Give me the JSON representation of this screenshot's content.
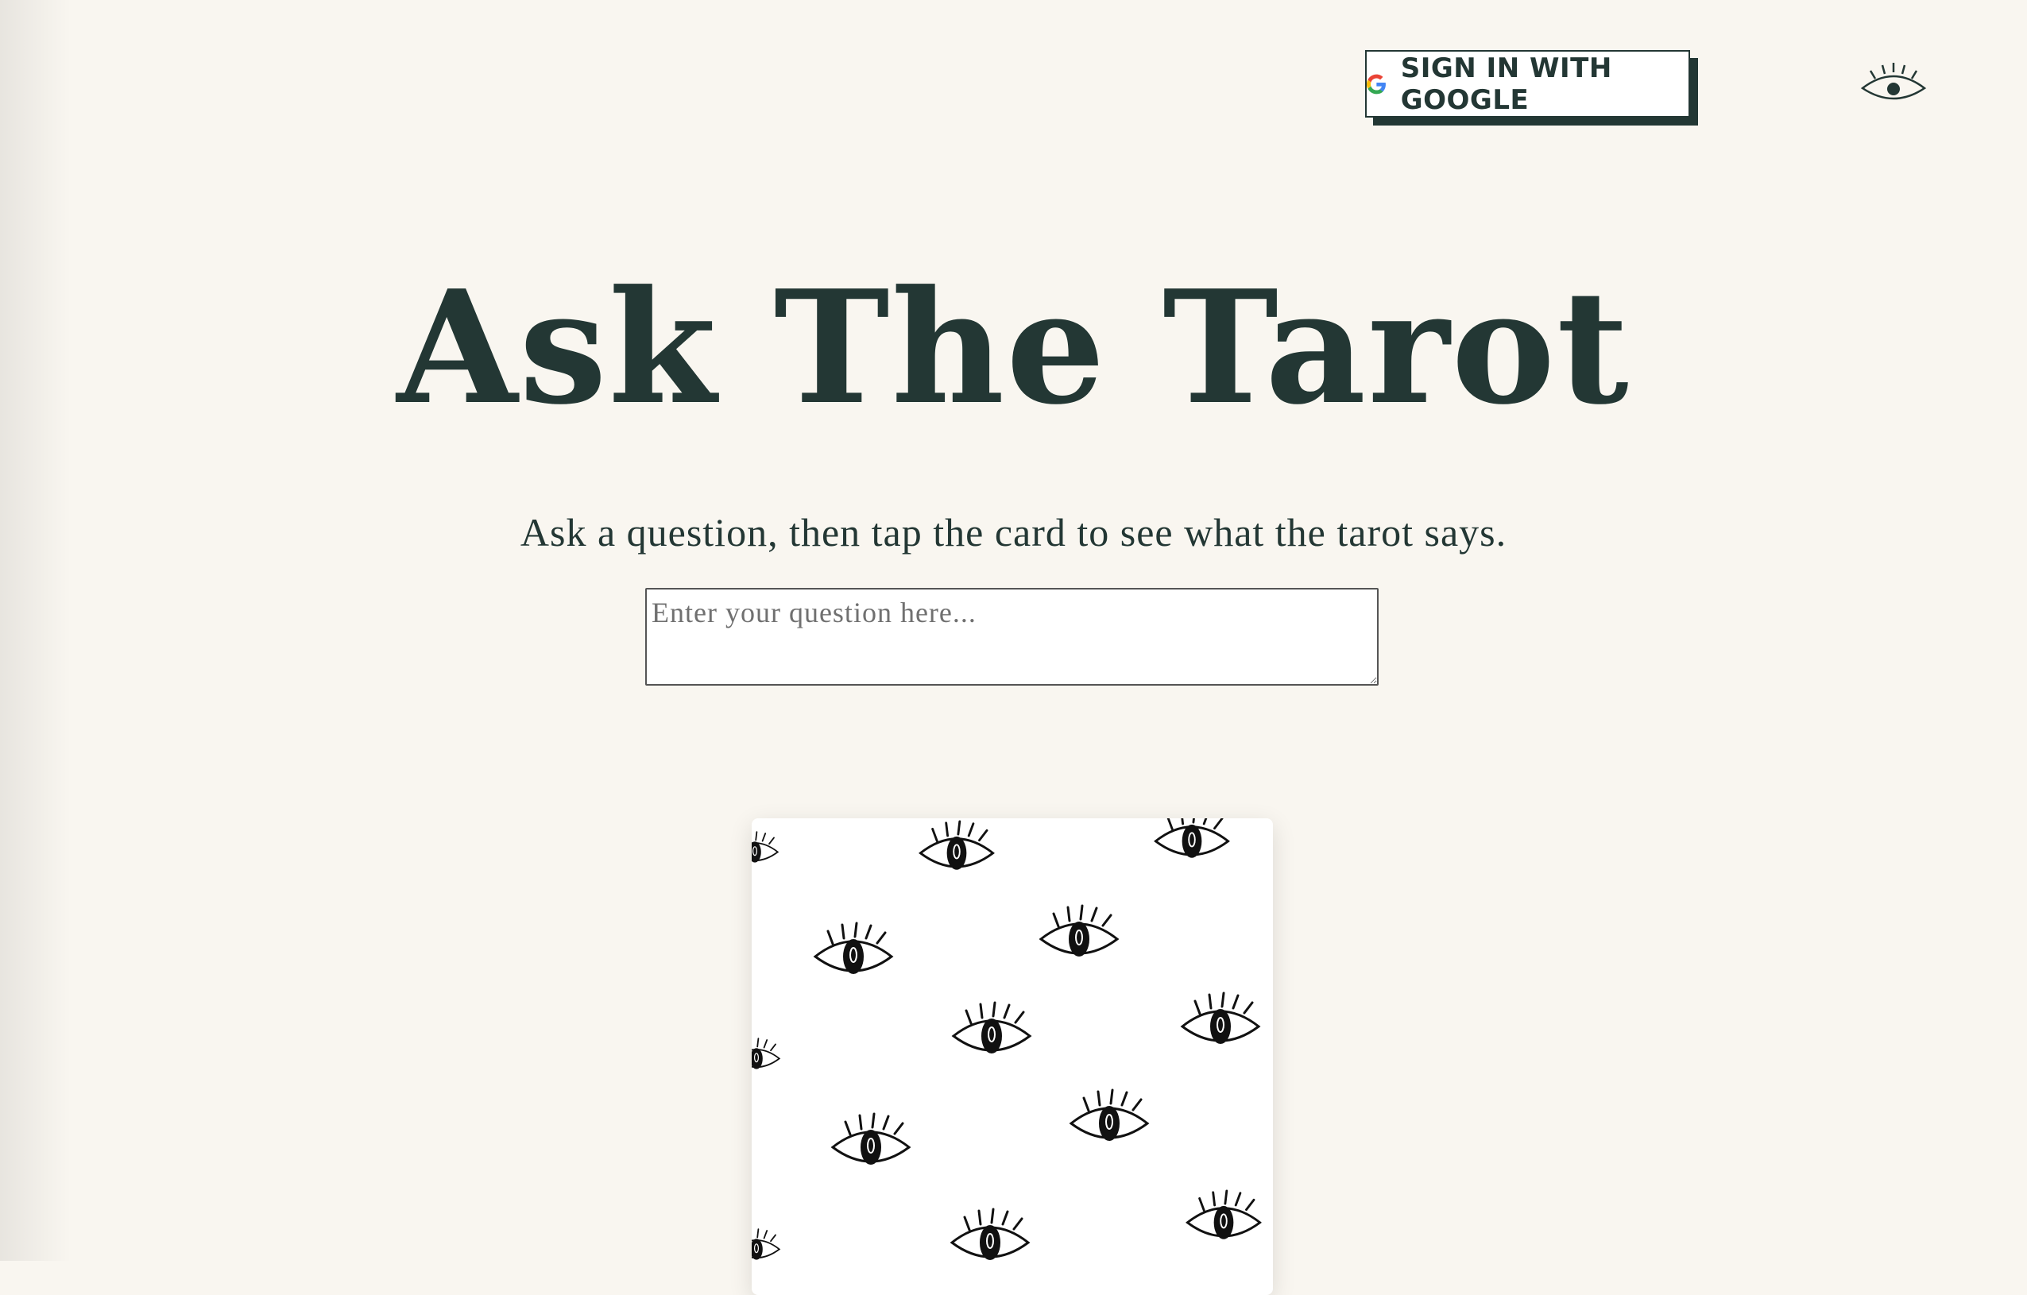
{
  "header": {
    "signin_label": "SIGN IN WITH GOOGLE",
    "google_colors": [
      "#4285F4",
      "#EA4335",
      "#FBBC05",
      "#34A853"
    ]
  },
  "hero": {
    "title": "Ask The Tarot",
    "subtitle": "Ask a question, then tap the card to see what the tarot says."
  },
  "question_input": {
    "value": "",
    "placeholder": "Enter your question here..."
  },
  "colors": {
    "background": "#f9f6f0",
    "ink": "#233734",
    "card": "#ffffff"
  },
  "icons": {
    "theme_toggle": "eye-icon",
    "google": "google-icon",
    "card_pattern": "eye-icon"
  }
}
